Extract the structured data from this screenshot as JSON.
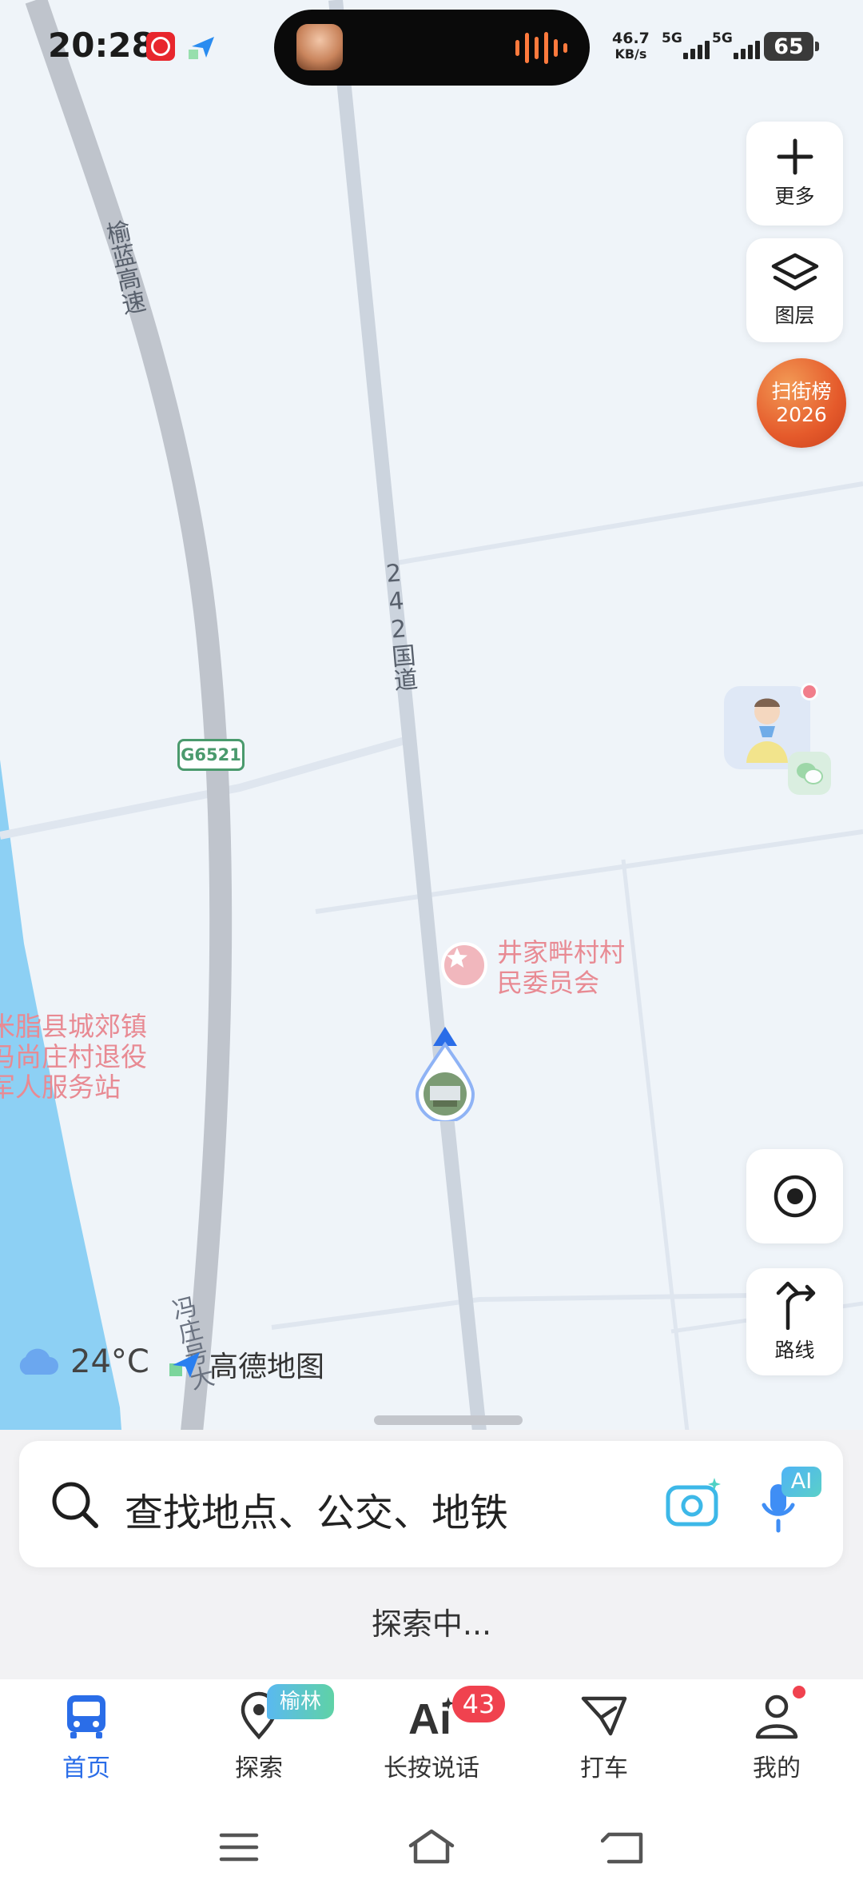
{
  "status_bar": {
    "time": "20:28",
    "net_speed_value": "46.7",
    "net_speed_unit": "KB/s",
    "signal_1": "5G",
    "signal_2": "5G",
    "battery": "65"
  },
  "map": {
    "roads": {
      "highway_name": "榆蓝高速",
      "national_road": "242国道",
      "local_road": "冯庄号大",
      "highway_code": "G6521"
    },
    "pois": {
      "village_committee": [
        "井家畔村村",
        "民委员会"
      ],
      "service_station": [
        "米脂县城郊镇",
        "冯尚庄村退役",
        "军人服务站"
      ]
    },
    "colors": {
      "road_gray": "#c2c7cf",
      "river": "#8dd0f4",
      "accent_blue": "#2a6de8",
      "poi_pink": "#e88a93"
    }
  },
  "controls": {
    "more_label": "更多",
    "layers_label": "图层",
    "rank_badge_line1": "扫街榜",
    "rank_badge_line2": "2026",
    "locate_icon": "target-icon",
    "route_label": "路线"
  },
  "weather": {
    "icon": "cloud-icon",
    "temperature": "24°C"
  },
  "brand": {
    "name": "高德地图"
  },
  "search": {
    "placeholder": "查找地点、公交、地铁",
    "ai_badge": "AI",
    "explore_status": "探索中..."
  },
  "bottom_nav": {
    "items": [
      {
        "label": "首页",
        "icon": "bus-icon",
        "active": true
      },
      {
        "label": "探索",
        "icon": "location-pin-icon",
        "badge": "榆林"
      },
      {
        "label": "长按说话",
        "icon": "ai-icon",
        "badge": "43"
      },
      {
        "label": "打车",
        "icon": "taxi-icon"
      },
      {
        "label": "我的",
        "icon": "user-icon",
        "dot": true
      }
    ]
  }
}
